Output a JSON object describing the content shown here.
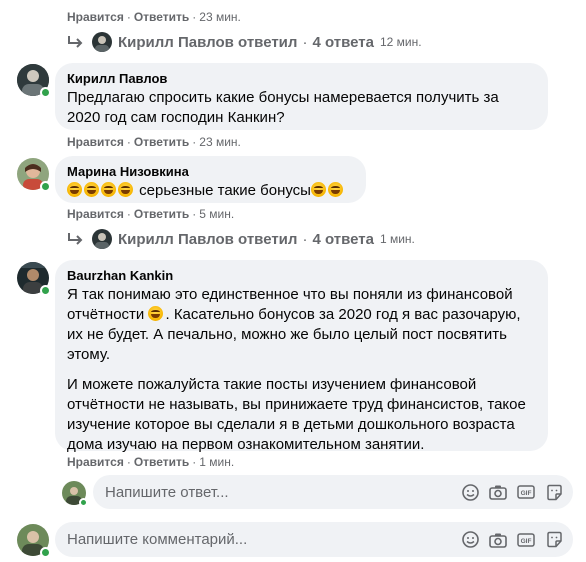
{
  "actions": {
    "like": "Нравится",
    "reply": "Ответить",
    "dot": "·"
  },
  "thread1": {
    "top_time": "23 мин.",
    "replies": {
      "author": "Кирилл Павлов",
      "verb": "ответил",
      "count": "4 ответа",
      "time": "12 мин."
    }
  },
  "comments": [
    {
      "author": "Кирилл Павлов",
      "text": "Предлагаю спросить какие бонусы намеревается получить за 2020 год сам господин Канкин?",
      "time": "23 мин."
    },
    {
      "author": "Марина Низовкина",
      "text": "серьезные такие бонусы",
      "time": "5 мин."
    },
    {
      "author": "Baurzhan Kankin",
      "p1": "Я так понимаю это единственное что вы поняли из финансовой отчётности",
      "p1b": "Касательно бонусов за 2020 год я вас разочарую, их не будет. А печально, можно же было целый пост посвятить этому.",
      "p2": "И можете пожалуйста такие посты изучением финансовой отчётности не называть, вы принижаете труд финансистов, такое изучение которое вы сделали я в детьми дошкольного возраста дома изучаю на первом ознакомительном занятии.",
      "time": "1 мин."
    }
  ],
  "thread2": {
    "replies": {
      "author": "Кирилл Павлов",
      "verb": "ответил",
      "count": "4 ответа",
      "time": "1 мин."
    }
  },
  "reply_input": {
    "placeholder": "Напишите ответ..."
  },
  "comment_input": {
    "placeholder": "Напишите комментарий..."
  },
  "icons": [
    "emoji-icon",
    "camera-icon",
    "gif-icon",
    "sticker-icon"
  ],
  "colors": {
    "online": "#31a24c",
    "bubble": "#f0f2f5",
    "meta": "#65676b"
  }
}
